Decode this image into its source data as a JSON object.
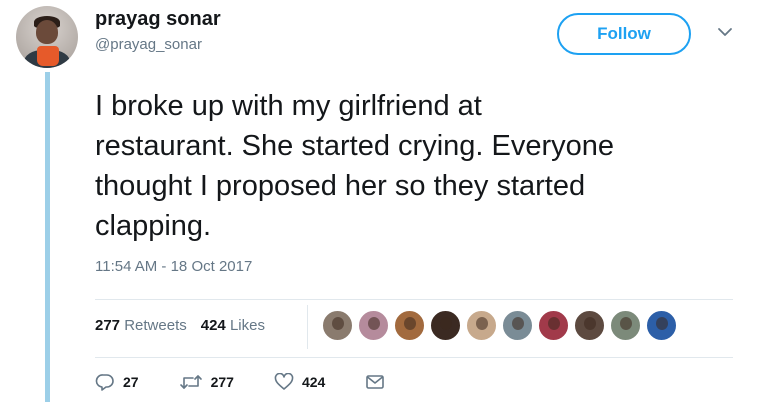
{
  "user": {
    "display_name": "prayag sonar",
    "handle": "@prayag_sonar"
  },
  "follow_button": {
    "label": "Follow"
  },
  "tweet": {
    "lines": [
      "I broke up with my girlfriend at",
      "restaurant. She started crying. Everyone",
      "thought I proposed her so they started",
      "clapping."
    ],
    "timestamp": "11:54 AM - 18 Oct 2017"
  },
  "stats": {
    "retweets_count": "277",
    "retweets_label": "Retweets",
    "likes_count": "424",
    "likes_label": "Likes"
  },
  "likers": [
    {
      "icon": "user-avatar",
      "color": "#8a7b6e"
    },
    {
      "icon": "user-avatar",
      "color": "#b58b9c"
    },
    {
      "icon": "user-avatar",
      "color": "#a26a3e"
    },
    {
      "icon": "user-avatar",
      "color": "#3b2a22"
    },
    {
      "icon": "user-avatar",
      "color": "#c7a98c"
    },
    {
      "icon": "user-avatar",
      "color": "#7a8c96"
    },
    {
      "icon": "user-avatar",
      "color": "#a13a4a"
    },
    {
      "icon": "user-avatar",
      "color": "#5d4a40"
    },
    {
      "icon": "user-avatar",
      "color": "#7c8a7a"
    },
    {
      "icon": "user-avatar",
      "color": "#2c5fa8"
    }
  ],
  "actions": {
    "reply_count": "27",
    "retweet_count": "277",
    "like_count": "424"
  },
  "colors": {
    "accent": "#1da1f2",
    "thread_line": "#9ccfe8",
    "muted_text": "#657786"
  }
}
